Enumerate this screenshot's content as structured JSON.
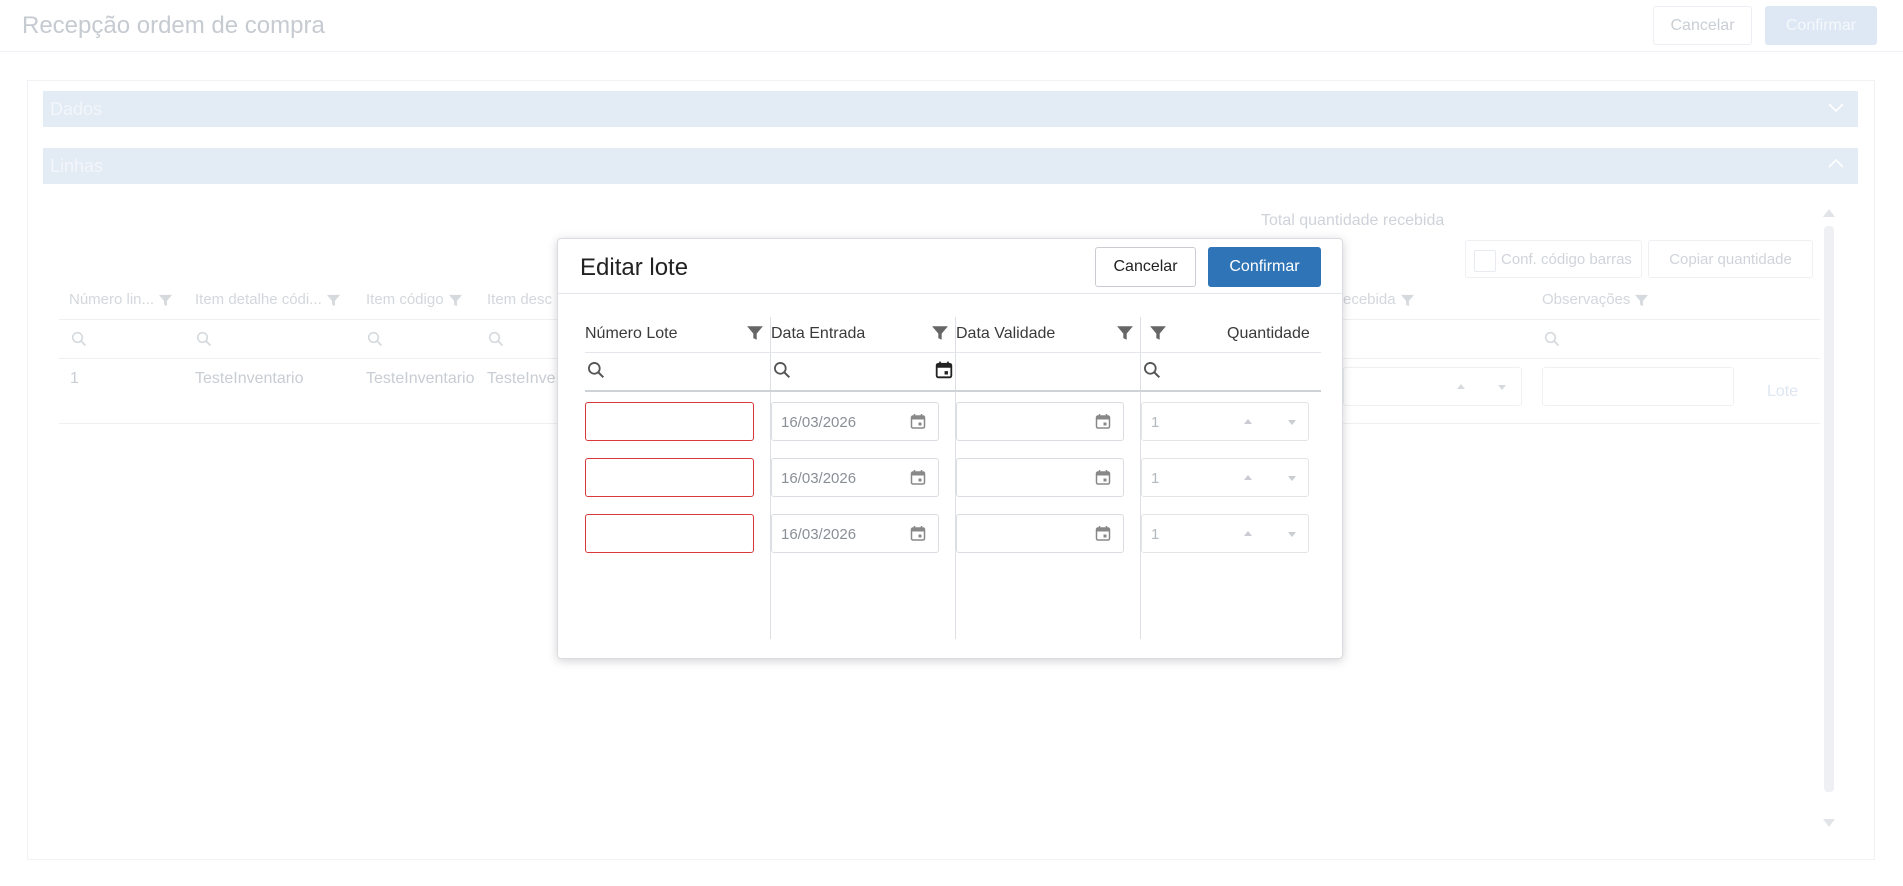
{
  "page": {
    "title": "Recepção ordem de compra",
    "cancel_label": "Cancelar",
    "confirm_label": "Confirmar"
  },
  "sections": {
    "dados": "Dados",
    "linhas": "Linhas"
  },
  "lines": {
    "total_label": "Total quantidade recebida",
    "barcode_label": "Conf. código barras",
    "copy_label": "Copiar quantidade",
    "columns": [
      "Número lin...",
      "Item detalhe códi...",
      "Item código",
      "Item desc",
      "ecebida",
      "Observações"
    ],
    "rows": [
      {
        "numero": "1",
        "detalhe": "TesteInventario",
        "codigo": "TesteInventario",
        "descricao": "TesteInve",
        "lote": "Lote"
      }
    ]
  },
  "modal": {
    "title": "Editar lote",
    "cancel_label": "Cancelar",
    "confirm_label": "Confirmar",
    "columns": {
      "numero_lote": "Número Lote",
      "data_entrada": "Data Entrada",
      "data_validade": "Data Validade",
      "quantidade": "Quantidade"
    },
    "rows": [
      {
        "numero_lote": "",
        "data_entrada": "16/03/2026",
        "data_validade": "",
        "quantidade": "1"
      },
      {
        "numero_lote": "",
        "data_entrada": "16/03/2026",
        "data_validade": "",
        "quantidade": "1"
      },
      {
        "numero_lote": "",
        "data_entrada": "16/03/2026",
        "data_validade": "",
        "quantidade": "1"
      }
    ]
  },
  "icons": {
    "filter": "filter-icon",
    "search": "search-icon",
    "calendar": "calendar-icon",
    "chevron": "chevron-icon"
  },
  "colors": {
    "primary": "#2f74b6",
    "error": "#d9393b",
    "section_bar": "#e3ebf5"
  }
}
